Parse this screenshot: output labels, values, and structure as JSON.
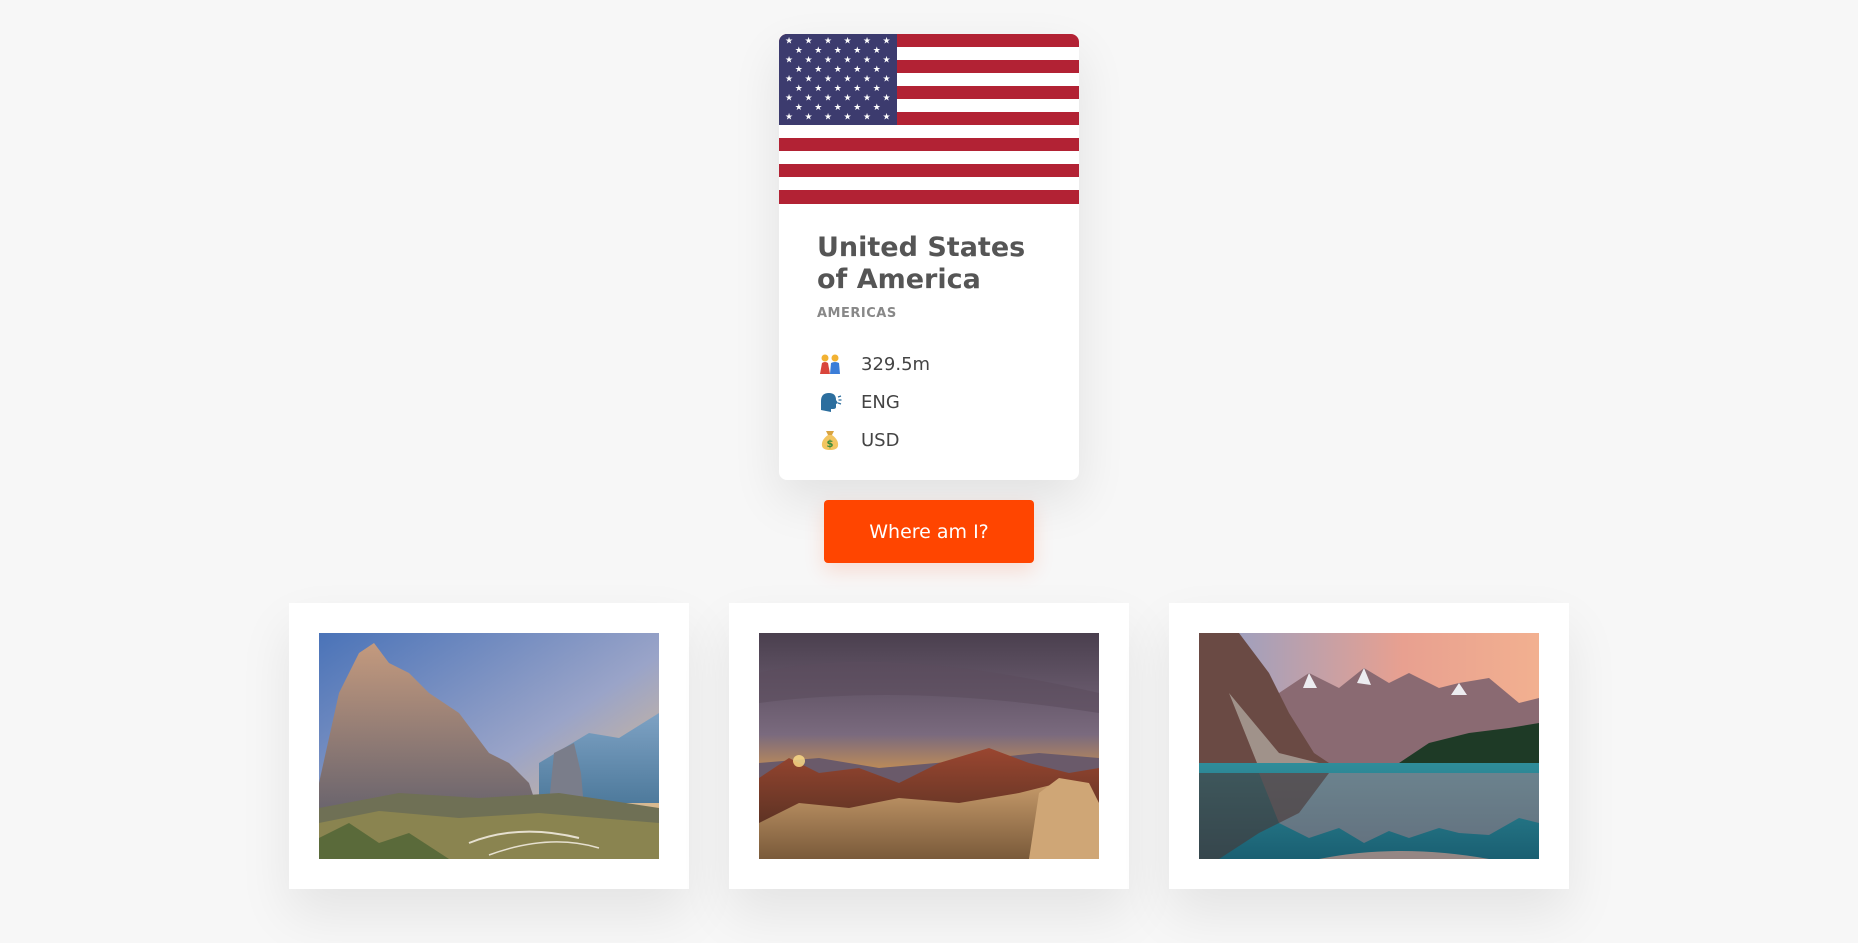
{
  "country": {
    "name": "United States of America",
    "region": "AMERICAS",
    "population": "329.5m",
    "language": "ENG",
    "currency": "USD",
    "flag": {
      "blue": "#3c3b6e",
      "red": "#b22234",
      "white": "#ffffff"
    }
  },
  "icons": {
    "population": "people-icon",
    "language": "speaking-head-icon",
    "currency": "money-bag-icon"
  },
  "button": {
    "label": "Where am I?",
    "color": "#ff4500"
  },
  "photos": [
    {
      "name": "mountain-dolomites-photo"
    },
    {
      "name": "red-rock-canyon-sunset-photo"
    },
    {
      "name": "mountain-lake-reflection-photo"
    }
  ]
}
